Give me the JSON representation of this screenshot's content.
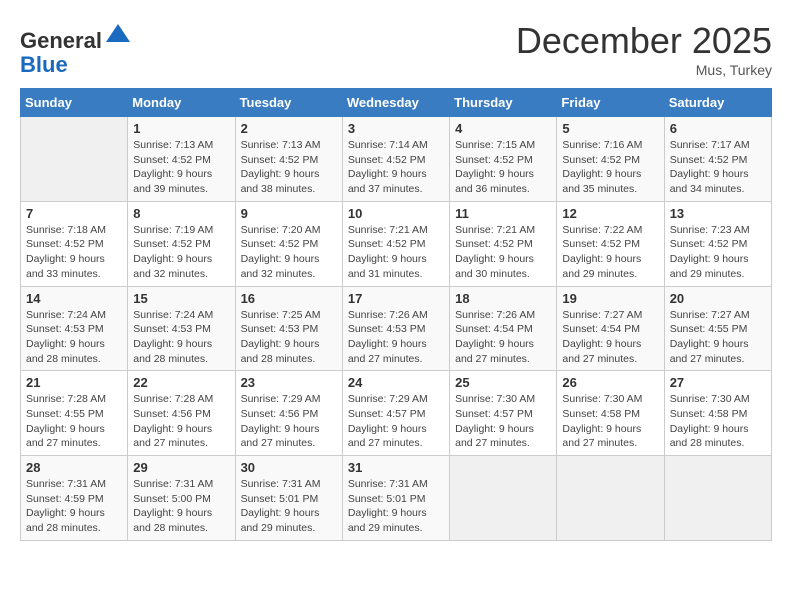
{
  "header": {
    "logo_line1": "General",
    "logo_line2": "Blue",
    "month": "December 2025",
    "location": "Mus, Turkey"
  },
  "weekdays": [
    "Sunday",
    "Monday",
    "Tuesday",
    "Wednesday",
    "Thursday",
    "Friday",
    "Saturday"
  ],
  "weeks": [
    [
      {
        "day": "",
        "info": ""
      },
      {
        "day": "1",
        "info": "Sunrise: 7:13 AM\nSunset: 4:52 PM\nDaylight: 9 hours\nand 39 minutes."
      },
      {
        "day": "2",
        "info": "Sunrise: 7:13 AM\nSunset: 4:52 PM\nDaylight: 9 hours\nand 38 minutes."
      },
      {
        "day": "3",
        "info": "Sunrise: 7:14 AM\nSunset: 4:52 PM\nDaylight: 9 hours\nand 37 minutes."
      },
      {
        "day": "4",
        "info": "Sunrise: 7:15 AM\nSunset: 4:52 PM\nDaylight: 9 hours\nand 36 minutes."
      },
      {
        "day": "5",
        "info": "Sunrise: 7:16 AM\nSunset: 4:52 PM\nDaylight: 9 hours\nand 35 minutes."
      },
      {
        "day": "6",
        "info": "Sunrise: 7:17 AM\nSunset: 4:52 PM\nDaylight: 9 hours\nand 34 minutes."
      }
    ],
    [
      {
        "day": "7",
        "info": "Sunrise: 7:18 AM\nSunset: 4:52 PM\nDaylight: 9 hours\nand 33 minutes."
      },
      {
        "day": "8",
        "info": "Sunrise: 7:19 AM\nSunset: 4:52 PM\nDaylight: 9 hours\nand 32 minutes."
      },
      {
        "day": "9",
        "info": "Sunrise: 7:20 AM\nSunset: 4:52 PM\nDaylight: 9 hours\nand 32 minutes."
      },
      {
        "day": "10",
        "info": "Sunrise: 7:21 AM\nSunset: 4:52 PM\nDaylight: 9 hours\nand 31 minutes."
      },
      {
        "day": "11",
        "info": "Sunrise: 7:21 AM\nSunset: 4:52 PM\nDaylight: 9 hours\nand 30 minutes."
      },
      {
        "day": "12",
        "info": "Sunrise: 7:22 AM\nSunset: 4:52 PM\nDaylight: 9 hours\nand 29 minutes."
      },
      {
        "day": "13",
        "info": "Sunrise: 7:23 AM\nSunset: 4:52 PM\nDaylight: 9 hours\nand 29 minutes."
      }
    ],
    [
      {
        "day": "14",
        "info": "Sunrise: 7:24 AM\nSunset: 4:53 PM\nDaylight: 9 hours\nand 28 minutes."
      },
      {
        "day": "15",
        "info": "Sunrise: 7:24 AM\nSunset: 4:53 PM\nDaylight: 9 hours\nand 28 minutes."
      },
      {
        "day": "16",
        "info": "Sunrise: 7:25 AM\nSunset: 4:53 PM\nDaylight: 9 hours\nand 28 minutes."
      },
      {
        "day": "17",
        "info": "Sunrise: 7:26 AM\nSunset: 4:53 PM\nDaylight: 9 hours\nand 27 minutes."
      },
      {
        "day": "18",
        "info": "Sunrise: 7:26 AM\nSunset: 4:54 PM\nDaylight: 9 hours\nand 27 minutes."
      },
      {
        "day": "19",
        "info": "Sunrise: 7:27 AM\nSunset: 4:54 PM\nDaylight: 9 hours\nand 27 minutes."
      },
      {
        "day": "20",
        "info": "Sunrise: 7:27 AM\nSunset: 4:55 PM\nDaylight: 9 hours\nand 27 minutes."
      }
    ],
    [
      {
        "day": "21",
        "info": "Sunrise: 7:28 AM\nSunset: 4:55 PM\nDaylight: 9 hours\nand 27 minutes."
      },
      {
        "day": "22",
        "info": "Sunrise: 7:28 AM\nSunset: 4:56 PM\nDaylight: 9 hours\nand 27 minutes."
      },
      {
        "day": "23",
        "info": "Sunrise: 7:29 AM\nSunset: 4:56 PM\nDaylight: 9 hours\nand 27 minutes."
      },
      {
        "day": "24",
        "info": "Sunrise: 7:29 AM\nSunset: 4:57 PM\nDaylight: 9 hours\nand 27 minutes."
      },
      {
        "day": "25",
        "info": "Sunrise: 7:30 AM\nSunset: 4:57 PM\nDaylight: 9 hours\nand 27 minutes."
      },
      {
        "day": "26",
        "info": "Sunrise: 7:30 AM\nSunset: 4:58 PM\nDaylight: 9 hours\nand 27 minutes."
      },
      {
        "day": "27",
        "info": "Sunrise: 7:30 AM\nSunset: 4:58 PM\nDaylight: 9 hours\nand 28 minutes."
      }
    ],
    [
      {
        "day": "28",
        "info": "Sunrise: 7:31 AM\nSunset: 4:59 PM\nDaylight: 9 hours\nand 28 minutes."
      },
      {
        "day": "29",
        "info": "Sunrise: 7:31 AM\nSunset: 5:00 PM\nDaylight: 9 hours\nand 28 minutes."
      },
      {
        "day": "30",
        "info": "Sunrise: 7:31 AM\nSunset: 5:01 PM\nDaylight: 9 hours\nand 29 minutes."
      },
      {
        "day": "31",
        "info": "Sunrise: 7:31 AM\nSunset: 5:01 PM\nDaylight: 9 hours\nand 29 minutes."
      },
      {
        "day": "",
        "info": ""
      },
      {
        "day": "",
        "info": ""
      },
      {
        "day": "",
        "info": ""
      }
    ]
  ]
}
